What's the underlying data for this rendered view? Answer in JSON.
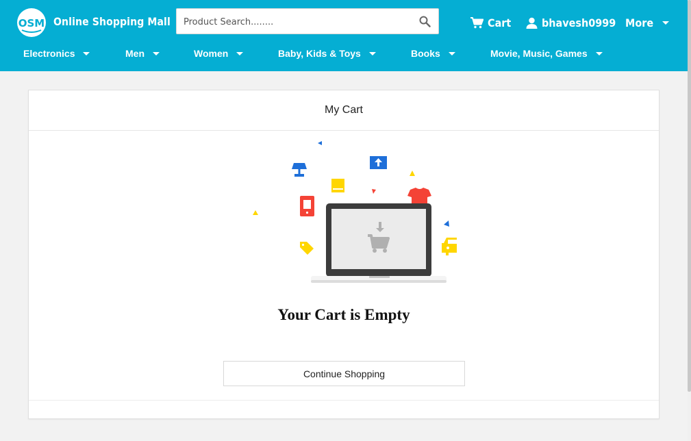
{
  "header": {
    "brand": "Online Shopping Mall",
    "logo_text": "OSM",
    "search": {
      "placeholder": "Product Search........",
      "value": ""
    },
    "cart_label": "Cart",
    "username": "bhavesh0999",
    "more_label": "More",
    "categories": [
      "Electronics",
      "Men",
      "Women",
      "Baby, Kids & Toys",
      "Books",
      "Movie, Music, Games"
    ]
  },
  "cart": {
    "title": "My Cart",
    "empty_message": "Your Cart is Empty",
    "continue_label": "Continue Shopping"
  },
  "colors": {
    "header_bg": "#05aed3",
    "page_bg": "#f2f2f2",
    "blue": "#1e6fd9",
    "red": "#f44336",
    "yellow": "#ffd600",
    "laptop": "#3c3c3c"
  },
  "icons": [
    "logo-icon",
    "search-icon",
    "cart-icon",
    "user-icon",
    "caret-down-icon",
    "empty-cart-illustration"
  ]
}
